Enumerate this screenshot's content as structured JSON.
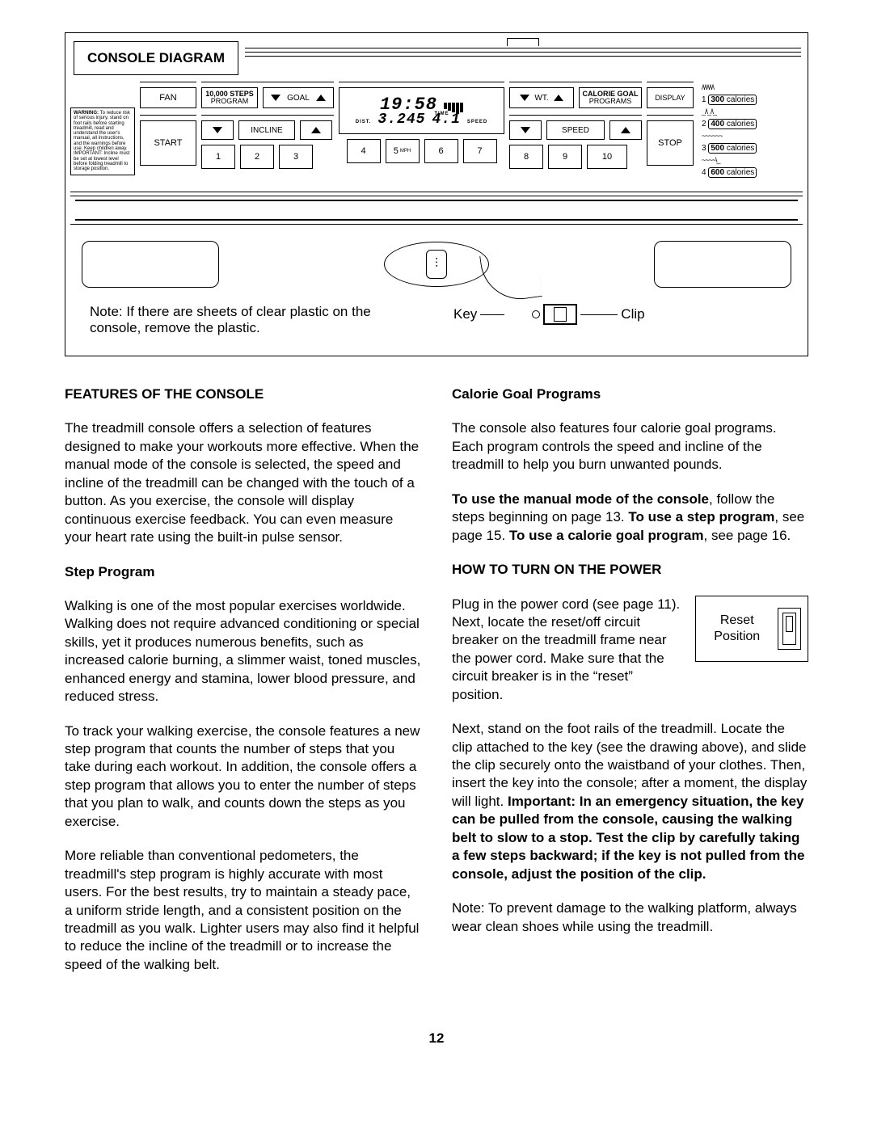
{
  "diagram": {
    "title": "CONSOLE DIAGRAM",
    "warning": {
      "heading": "WARNING:",
      "body": "To reduce risk of serious injury, stand on foot rails before starting treadmill, read and understand the user's manual, all instructions, and the warnings before use. Keep children away. IMPORTANT: Incline must be set at lowest level before folding treadmill to storage position."
    },
    "labels": {
      "fan": "FAN",
      "steps_program_top": "10,000 STEPS",
      "steps_program_sub": "PROGRAM",
      "goal": "GOAL",
      "incline": "INCLINE",
      "start": "START",
      "wt": "WT.",
      "calorie_goal_top": "CALORIE GOAL",
      "calorie_goal_sub": "PROGRAMS",
      "display": "DISPLAY",
      "speed": "SPEED",
      "stop": "STOP",
      "mph": "MPH"
    },
    "lcd": {
      "time": "19:58",
      "time_label": "TIME",
      "dist_label": "DIST.",
      "dist": "3.245",
      "speed": "4.1",
      "speed_label": "SPEED"
    },
    "numbers": [
      "1",
      "2",
      "3",
      "4",
      "5",
      "6",
      "7",
      "8",
      "9",
      "10"
    ],
    "calorie_presets": [
      {
        "n": "1",
        "val": "300",
        "unit": "calories"
      },
      {
        "n": "2",
        "val": "400",
        "unit": "calories"
      },
      {
        "n": "3",
        "val": "500",
        "unit": "calories"
      },
      {
        "n": "4",
        "val": "600",
        "unit": "calories"
      }
    ],
    "note": "Note: If there are sheets of clear plastic on the console, remove the plastic.",
    "key_label": "Key",
    "clip_label": "Clip"
  },
  "body": {
    "left": {
      "h1": "FEATURES OF THE CONSOLE",
      "p1": "The treadmill console offers a selection of features designed to make your workouts more effective. When the manual mode of the console is selected, the speed and incline of the treadmill can be changed with the touch of a button. As you exercise, the console will display continuous exercise feedback. You can even measure your heart rate using the built-in pulse sensor.",
      "h2": "Step Program",
      "p2": "Walking is one of the most popular exercises worldwide. Walking does not require advanced conditioning or special skills, yet it produces numerous benefits, such as increased calorie burning, a slimmer waist, toned muscles, enhanced energy and stamina, lower blood pressure, and reduced stress.",
      "p3": "To track your walking exercise, the console features a new step program that counts the number of steps that you take during each workout. In addition, the console offers a step program that allows you to enter the number of steps that you plan to walk, and counts down the steps as you exercise.",
      "p4": "More reliable than conventional pedometers, the treadmill's step program is highly accurate with most users. For the best results, try to maintain a steady pace, a uniform stride length, and a consistent position on the treadmill as you walk. Lighter users may also find it helpful to reduce the incline of the treadmill or to increase the speed of the walking belt."
    },
    "right": {
      "h2a": "Calorie Goal Programs",
      "p1": "The console also features four calorie goal programs. Each program controls the speed and incline of the treadmill to help you burn unwanted pounds.",
      "p2_a": "To use the manual mode of the console",
      "p2_b": ", follow the steps beginning on page 13. ",
      "p2_c": "To use a step program",
      "p2_d": ", see page 15. ",
      "p2_e": "To use a calorie goal program",
      "p2_f": ", see page 16.",
      "h1": "HOW TO TURN ON THE POWER",
      "reset_caption": "Reset Position",
      "p3": "Plug in the power cord (see page 11). Next, locate the reset/off circuit breaker on the treadmill frame near the power cord. Make sure that the circuit breaker is in the “reset” position.",
      "p4_a": "Next, stand on the foot rails of the treadmill. Locate the clip attached to the key (see the drawing above), and slide the clip securely onto the waistband of your clothes. Then, insert the key into the console; after a moment, the display will light. ",
      "p4_b": "Important: In an emergency situation, the key can be pulled from the console, causing the walking belt to slow to a stop. Test the clip by carefully taking a few steps backward; if the key is not pulled from the console, adjust the position of the clip.",
      "p5": "Note: To prevent damage to the walking platform, always wear clean shoes while using the treadmill."
    }
  },
  "page_number": "12"
}
